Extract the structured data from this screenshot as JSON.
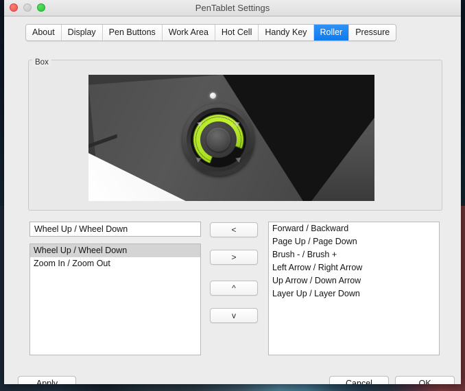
{
  "window": {
    "title": "PenTablet Settings",
    "traffic_lights": [
      {
        "name": "close",
        "color": "#f05149"
      },
      {
        "name": "minimize",
        "color": "#c8c8c8"
      },
      {
        "name": "zoom",
        "color": "#28c33f"
      }
    ]
  },
  "tabs": [
    {
      "label": "About",
      "active": false
    },
    {
      "label": "Display",
      "active": false
    },
    {
      "label": "Pen Buttons",
      "active": false
    },
    {
      "label": "Work Area",
      "active": false
    },
    {
      "label": "Hot Cell",
      "active": false
    },
    {
      "label": "Handy Key",
      "active": false
    },
    {
      "label": "Roller",
      "active": true
    },
    {
      "label": "Pressure",
      "active": false
    }
  ],
  "groupbox": {
    "label": "Box",
    "device_image": "pen-tablet-roller-wheel-illuminated-green"
  },
  "current_function": {
    "value": "Wheel Up / Wheel Down",
    "placeholder": ""
  },
  "assigned_list": {
    "items": [
      {
        "label": "Wheel Up / Wheel Down",
        "selected": true
      },
      {
        "label": "Zoom In / Zoom Out",
        "selected": false
      }
    ]
  },
  "available_list": {
    "items": [
      {
        "label": "Forward / Backward",
        "selected": false
      },
      {
        "label": "Page Up / Page Down",
        "selected": false
      },
      {
        "label": "Brush - / Brush +",
        "selected": false
      },
      {
        "label": "Left Arrow / Right Arrow",
        "selected": false
      },
      {
        "label": "Up Arrow / Down Arrow",
        "selected": false
      },
      {
        "label": "Layer Up / Layer Down",
        "selected": false
      }
    ]
  },
  "transfer_buttons": {
    "move_left": "<",
    "move_right": ">",
    "move_up": "^",
    "move_down": "v"
  },
  "footer": {
    "apply": "Apply",
    "cancel": "Cancel",
    "ok": "OK"
  },
  "colors": {
    "accent": "#0e7bef",
    "window_bg": "#ececec",
    "selection": "#d4d4d4",
    "roller_led": "#b7ea2a"
  }
}
